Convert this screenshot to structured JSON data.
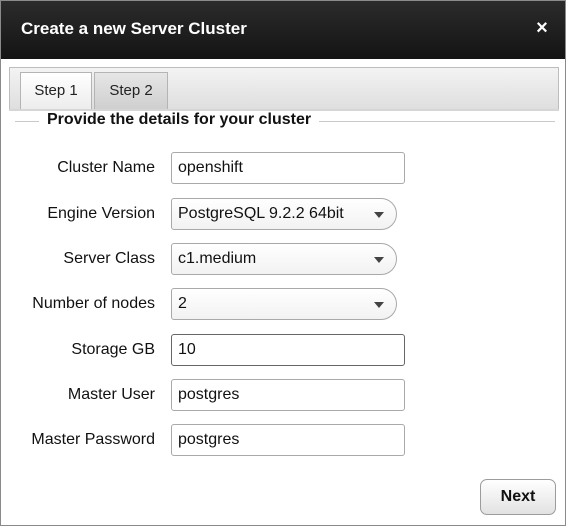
{
  "dialog": {
    "title": "Create a new Server Cluster",
    "close_glyph": "×"
  },
  "tabs": [
    {
      "label": "Step 1",
      "active": true
    },
    {
      "label": "Step 2",
      "active": false
    }
  ],
  "section": {
    "legend": "Provide the details for your cluster"
  },
  "fields": {
    "cluster_name": {
      "label": "Cluster Name",
      "value": "openshift"
    },
    "engine_version": {
      "label": "Engine Version",
      "value": "PostgreSQL 9.2.2 64bit"
    },
    "server_class": {
      "label": "Server Class",
      "value": "c1.medium"
    },
    "number_of_nodes": {
      "label": "Number of nodes",
      "value": "2"
    },
    "storage_gb": {
      "label": "Storage GB",
      "value": "10"
    },
    "master_user": {
      "label": "Master User",
      "value": "postgres"
    },
    "master_password": {
      "label": "Master Password",
      "value": "postgres"
    }
  },
  "actions": {
    "next_label": "Next"
  },
  "icons": {
    "close": "close-icon",
    "dropdown": "chevron-down-icon"
  },
  "colors": {
    "titlebar": "#1e1e1e",
    "title_text": "#ffffff"
  }
}
